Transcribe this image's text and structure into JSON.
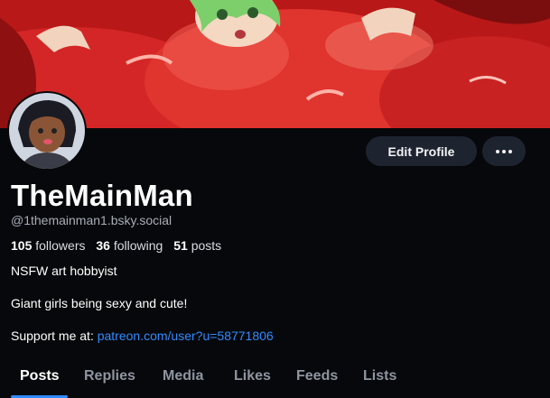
{
  "profile": {
    "display_name": "TheMainMan",
    "handle": "@1themainman1.bsky.social",
    "followers_count": "105",
    "followers_label": "followers",
    "following_count": "36",
    "following_label": "following",
    "posts_count": "51",
    "posts_label": "posts",
    "bio_line1": "NSFW art hobbyist",
    "bio_line2": "Giant girls being sexy and cute!",
    "support_label": "Support me at: ",
    "support_link": "patreon.com/user?u=58771806"
  },
  "actions": {
    "edit_profile_label": "Edit Profile",
    "more_icon": "ellipsis-icon"
  },
  "tabs": [
    {
      "label": "Posts",
      "active": true
    },
    {
      "label": "Replies",
      "active": false
    },
    {
      "label": "Media",
      "active": false
    },
    {
      "label": "Likes",
      "active": false
    },
    {
      "label": "Feeds",
      "active": false
    },
    {
      "label": "Lists",
      "active": false
    }
  ],
  "colors": {
    "background": "#07080b",
    "accent": "#2f8bff",
    "button_bg": "#1e2330",
    "banner_red": "#c41e1e"
  }
}
